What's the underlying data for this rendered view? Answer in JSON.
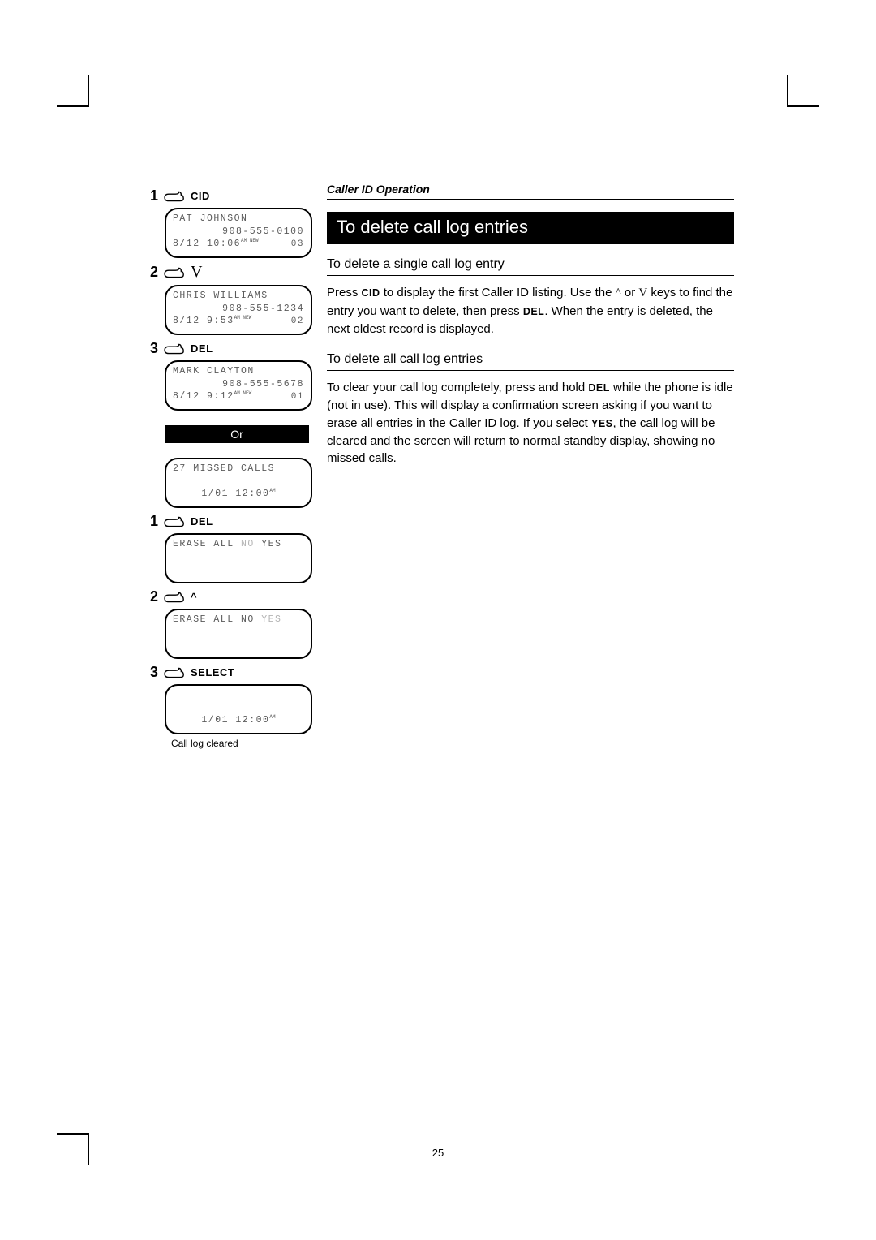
{
  "header": {
    "section": "Caller ID Operation"
  },
  "title": "To delete call log entries",
  "sections": [
    {
      "subtitle": "To delete a single call log entry",
      "text_parts": [
        "Press ",
        {
          "kw": "CID"
        },
        " to display the first Caller ID listing. Use the ",
        {
          "sym": "^"
        },
        " or ",
        {
          "sym": "V"
        },
        " keys to find the entry you want to delete, then press ",
        {
          "kw": "DEL"
        },
        ". When the entry is deleted, the next oldest record is displayed."
      ]
    },
    {
      "subtitle": "To delete all call log entries",
      "text_parts": [
        "To clear your call log completely, press and hold ",
        {
          "kw": "DEL"
        },
        " while the phone is idle (not in use). This will display a confirmation screen asking if you want to erase all entries in the Caller ID log. If you select ",
        {
          "kw": "YES"
        },
        ", the call log will be cleared and the screen will return to normal standby display, showing no missed calls."
      ]
    }
  ],
  "left_sequence_a": [
    {
      "num": "1",
      "label": "CID",
      "lcd": {
        "name": "PAT JOHNSON",
        "phone": "908-555-0100",
        "date": "8/12",
        "time": "10:06",
        "sup": "AM NEW",
        "idx": "03"
      }
    },
    {
      "num": "2",
      "label_sym": "V",
      "lcd": {
        "name": "CHRIS WILLIAMS",
        "phone": "908-555-1234",
        "date": "8/12",
        "time": "9:53",
        "sup": "AM NEW",
        "idx": "02"
      }
    },
    {
      "num": "3",
      "label": "DEL",
      "lcd": {
        "name": "MARK CLAYTON",
        "phone": "908-555-5678",
        "date": "8/12",
        "time": "9:12",
        "sup": "AM NEW",
        "idx": "01"
      }
    }
  ],
  "or_label": "Or",
  "standby_lcd": {
    "line1": "27 MISSED CALLS",
    "line3": "1/01  12:00",
    "sup": "AM"
  },
  "left_sequence_b": [
    {
      "num": "1",
      "label": "DEL",
      "lcd": {
        "prompt": "ERASE ALL",
        "no": "NO",
        "yes": "YES",
        "dim_yes": false,
        "dim_no": true
      }
    },
    {
      "num": "2",
      "label_plain": "^",
      "lcd": {
        "prompt": "ERASE ALL",
        "no": "NO",
        "yes": "YES",
        "dim_yes": true,
        "dim_no": false
      }
    },
    {
      "num": "3",
      "label": "SELECT",
      "lcd": {
        "line3": "1/01  12:00",
        "sup": "AM"
      },
      "caption": "Call log cleared"
    }
  ],
  "page_number": "25"
}
